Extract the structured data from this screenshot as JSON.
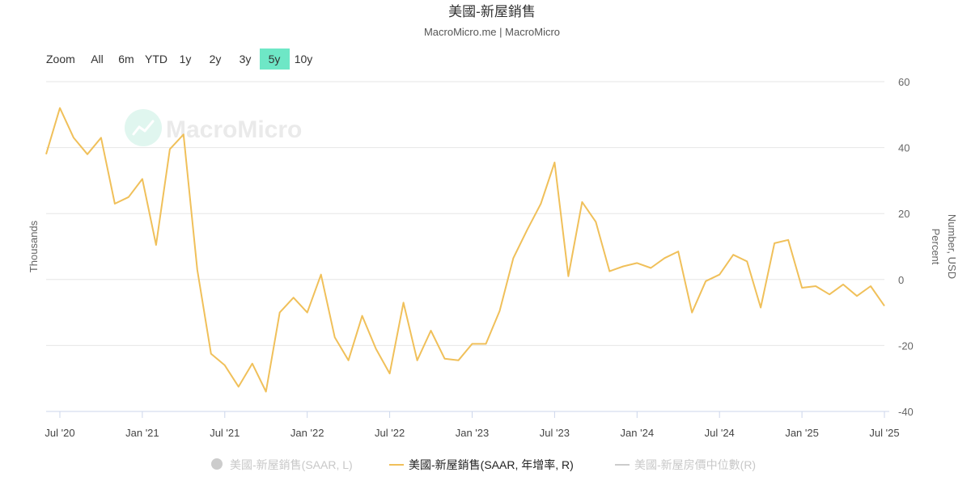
{
  "header": {
    "title": "美國-新屋銷售",
    "subtitle": "MacroMicro.me | MacroMicro"
  },
  "watermark": {
    "text": "MacroMicro",
    "icon": "macromicro-logo-icon"
  },
  "zoom": {
    "label": "Zoom",
    "buttons": [
      "All",
      "6m",
      "YTD",
      "1y",
      "2y",
      "3y",
      "5y",
      "10y"
    ],
    "active": "5y",
    "active_color": "#6ee7c6"
  },
  "axes": {
    "left_title": "Thousands",
    "right_title_1": "Number, USD",
    "right_title_2": "Percent"
  },
  "legend": [
    {
      "label": "美國-新屋銷售(SAAR, L)",
      "marker": "circle",
      "color": "#cccccc",
      "active": false
    },
    {
      "label": "美國-新屋銷售(SAAR, 年增率, R)",
      "marker": "line",
      "color": "#f0c05a",
      "active": true
    },
    {
      "label": "美國-新屋房價中位數(R)",
      "marker": "line",
      "color": "#cccccc",
      "active": false
    }
  ],
  "chart_data": {
    "type": "line",
    "title": "美國-新屋銷售",
    "subtitle": "MacroMicro.me | MacroMicro",
    "series": [
      {
        "name": "美國-新屋銷售(SAAR, 年增率, R)",
        "color": "#f0c05a",
        "axis": "right",
        "x": [
          "2020-06",
          "2020-07",
          "2020-08",
          "2020-09",
          "2020-10",
          "2020-11",
          "2020-12",
          "2021-01",
          "2021-02",
          "2021-03",
          "2021-04",
          "2021-05",
          "2021-06",
          "2021-07",
          "2021-08",
          "2021-09",
          "2021-10",
          "2021-11",
          "2021-12",
          "2022-01",
          "2022-02",
          "2022-03",
          "2022-04",
          "2022-05",
          "2022-06",
          "2022-07",
          "2022-08",
          "2022-09",
          "2022-10",
          "2022-11",
          "2022-12",
          "2023-01",
          "2023-02",
          "2023-03",
          "2023-04",
          "2023-05",
          "2023-06",
          "2023-07",
          "2023-08",
          "2023-09",
          "2023-10",
          "2023-11",
          "2023-12",
          "2024-01",
          "2024-02",
          "2024-03",
          "2024-04",
          "2024-05",
          "2024-06",
          "2024-07",
          "2024-08",
          "2024-09",
          "2024-10",
          "2024-11",
          "2024-12",
          "2025-01",
          "2025-02",
          "2025-03",
          "2025-04",
          "2025-05",
          "2025-06",
          "2025-07"
        ],
        "values": [
          38,
          52,
          43,
          38,
          43,
          23,
          25,
          30.5,
          10.5,
          39.5,
          44,
          3,
          -22.5,
          -26,
          -32.5,
          -25.5,
          -34,
          -10,
          -5.5,
          -10,
          1.5,
          -17.5,
          -24.5,
          -11,
          -21,
          -28.5,
          -7,
          -24.5,
          -15.5,
          -24,
          -24.5,
          -19.5,
          -19.5,
          -9.5,
          6.5,
          15,
          23,
          35.5,
          1,
          23.5,
          17.5,
          2.5,
          4,
          5,
          3.5,
          6.5,
          8.5,
          -10,
          -0.5,
          1.5,
          7.5,
          5.5,
          -8.5,
          11,
          12,
          -2.5,
          -2,
          -4.5,
          -1.5,
          -5,
          -2,
          -8
        ]
      }
    ],
    "x_ticks": [
      "Jul '20",
      "Jan '21",
      "Jul '21",
      "Jan '22",
      "Jul '22",
      "Jan '23",
      "Jul '23",
      "Jan '24",
      "Jul '24",
      "Jan '25",
      "Jul '25"
    ],
    "x_tick_dates": [
      "2020-07",
      "2021-01",
      "2021-07",
      "2022-01",
      "2022-07",
      "2023-01",
      "2023-07",
      "2024-01",
      "2024-07",
      "2025-01",
      "2025-07"
    ],
    "x_range": [
      "2020-06",
      "2025-07"
    ],
    "right_axis": {
      "ticks": [
        60,
        40,
        20,
        0,
        -20,
        -40
      ],
      "ylim": [
        -40,
        60
      ]
    },
    "ylabel_left": "Thousands",
    "ylabel_right": [
      "Number, USD",
      "Percent"
    ],
    "grid": true,
    "legend_placement": "bottom"
  }
}
